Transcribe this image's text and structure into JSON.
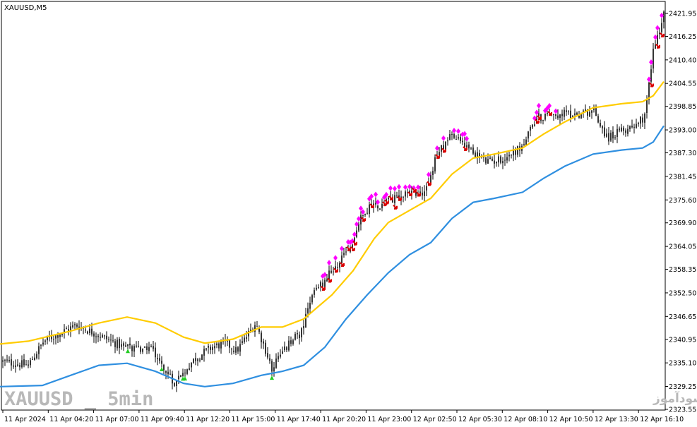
{
  "chart_data": {
    "type": "candlestick",
    "title": "XAUUSD,M5",
    "y_axis": {
      "position": "right",
      "ticks": [
        "2421.95",
        "2416.25",
        "2410.40",
        "2404.55",
        "2398.85",
        "2393.00",
        "2387.30",
        "2381.45",
        "2375.60",
        "2369.90",
        "2364.05",
        "2358.35",
        "2352.50",
        "2346.65",
        "2340.95",
        "2335.10",
        "2329.25",
        "2323.55"
      ],
      "ylim": [
        2323.0,
        2424.0
      ]
    },
    "x_axis": {
      "ticks": [
        "11 Apr 2024",
        "11 Apr 04:20",
        "11 Apr 07:00",
        "11 Apr 09:40",
        "11 Apr 12:20",
        "11 Apr 15:00",
        "11 Apr 17:40",
        "11 Apr 20:20",
        "11 Apr 23:00",
        "12 Apr 02:50",
        "12 Apr 05:30",
        "12 Apr 08:10",
        "12 Apr 10:50",
        "12 Apr 13:30",
        "12 Apr 16:10"
      ]
    },
    "price_path": [
      [
        0,
        2335.5
      ],
      [
        40,
        2334.5
      ],
      [
        62,
        2340.5
      ],
      [
        108,
        2344.5
      ],
      [
        140,
        2342
      ],
      [
        175,
        2339
      ],
      [
        195,
        2338.5
      ],
      [
        215,
        2339
      ],
      [
        245,
        2330
      ],
      [
        275,
        2336
      ],
      [
        300,
        2339
      ],
      [
        320,
        2340
      ],
      [
        335,
        2338
      ],
      [
        362,
        2345
      ],
      [
        385,
        2334
      ],
      [
        410,
        2340
      ],
      [
        428,
        2343
      ],
      [
        440,
        2351
      ],
      [
        470,
        2358
      ],
      [
        495,
        2363
      ],
      [
        515,
        2373
      ],
      [
        545,
        2375
      ],
      [
        575,
        2377
      ],
      [
        605,
        2378
      ],
      [
        615,
        2385
      ],
      [
        637,
        2392
      ],
      [
        665,
        2388
      ],
      [
        690,
        2385
      ],
      [
        715,
        2386
      ],
      [
        740,
        2389
      ],
      [
        760,
        2396
      ],
      [
        790,
        2397
      ],
      [
        820,
        2397
      ],
      [
        840,
        2398
      ],
      [
        860,
        2391
      ],
      [
        885,
        2393
      ],
      [
        912,
        2396
      ],
      [
        925,
        2413
      ],
      [
        935,
        2418
      ],
      [
        940,
        2423
      ]
    ],
    "series": [
      {
        "color": "#ffcc00",
        "points": [
          [
            0,
            2339.8
          ],
          [
            40,
            2340.5
          ],
          [
            100,
            2343
          ],
          [
            140,
            2345
          ],
          [
            180,
            2346.5
          ],
          [
            220,
            2345
          ],
          [
            260,
            2341.5
          ],
          [
            290,
            2340
          ],
          [
            330,
            2341
          ],
          [
            370,
            2344
          ],
          [
            400,
            2344
          ],
          [
            430,
            2346
          ],
          [
            470,
            2352
          ],
          [
            500,
            2358
          ],
          [
            530,
            2366
          ],
          [
            550,
            2370
          ],
          [
            580,
            2373
          ],
          [
            610,
            2376
          ],
          [
            640,
            2382
          ],
          [
            670,
            2386
          ],
          [
            700,
            2387
          ],
          [
            740,
            2388.5
          ],
          [
            770,
            2392
          ],
          [
            800,
            2395
          ],
          [
            840,
            2398.5
          ],
          [
            880,
            2399.5
          ],
          [
            910,
            2400
          ],
          [
            925,
            2401.5
          ],
          [
            940,
            2405
          ]
        ]
      },
      {
        "color": "#2f8fe0",
        "points": [
          [
            0,
            2329.2
          ],
          [
            60,
            2329.5
          ],
          [
            100,
            2332
          ],
          [
            140,
            2334.5
          ],
          [
            180,
            2335
          ],
          [
            220,
            2333
          ],
          [
            260,
            2330
          ],
          [
            290,
            2329.2
          ],
          [
            330,
            2330
          ],
          [
            370,
            2332
          ],
          [
            400,
            2333
          ],
          [
            430,
            2334.5
          ],
          [
            460,
            2339
          ],
          [
            490,
            2346
          ],
          [
            520,
            2352
          ],
          [
            550,
            2357.5
          ],
          [
            580,
            2362
          ],
          [
            610,
            2365
          ],
          [
            640,
            2371
          ],
          [
            670,
            2375
          ],
          [
            700,
            2376
          ],
          [
            740,
            2377.5
          ],
          [
            770,
            2381
          ],
          [
            800,
            2384
          ],
          [
            840,
            2387
          ],
          [
            880,
            2388
          ],
          [
            910,
            2388.5
          ],
          [
            925,
            2390
          ],
          [
            940,
            2394
          ]
        ]
      }
    ]
  },
  "watermark": {
    "left": "XAUUSD _ 5min",
    "right": "انتشار در سایت سودآموز"
  },
  "colors": {
    "candle": "#000000",
    "sell_marker": "#dd0000",
    "buy_marker": "#22cc22",
    "high_marker": "#ff00ff"
  }
}
